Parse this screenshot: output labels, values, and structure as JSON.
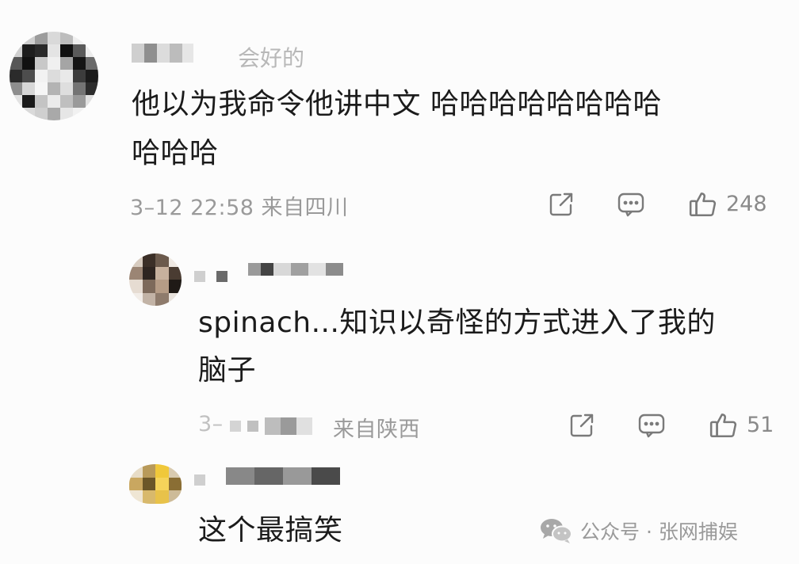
{
  "comments": [
    {
      "username_partial": "会好的",
      "text_line1": "他以为我命令他讲中文 哈哈哈哈哈哈哈哈",
      "text_line2": "哈哈哈",
      "meta": "3–12 22:58  来自四川",
      "likes": "248"
    },
    {
      "text_line1": "spinach...知识以奇怪的方式进入了我的",
      "text_line2": "脑子",
      "meta_visible": "来自陕西",
      "meta_partial": "3–",
      "likes": "51"
    },
    {
      "text_line1": "这个最搞笑"
    }
  ],
  "watermark": {
    "text": "公众号 · 张网捕娱",
    "icon": "wechat-icon"
  },
  "icons": {
    "share": "share-icon",
    "reply": "comment-icon",
    "like": "thumbs-up-icon"
  },
  "colors": {
    "background": "#fcfcfc",
    "text": "#1b1b1b",
    "meta": "#9a9a9a"
  }
}
